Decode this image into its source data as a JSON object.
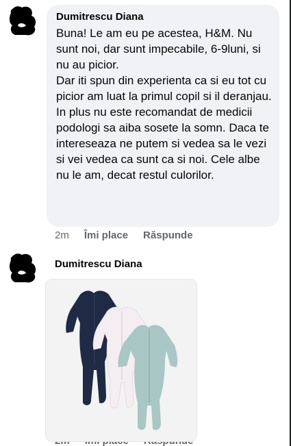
{
  "comment1": {
    "author": "Dumitrescu Diana",
    "text": "Buna! Le am eu pe acestea, H&M. Nu sunt noi, dar sunt impecabile, 6-9luni, si nu au picior.\nDar iti spun din experienta ca si eu tot cu picior am luat la primul copil si il deranjau. In plus nu este recomandat de medicii podologi sa aiba sosete la somn.  Daca te intereseaza ne putem si vedea sa le vezi si vei vedea ca sunt ca si noi. Cele albe nu le am, decat restul culorilor.",
    "time": "2m",
    "like_label": "Îmi place",
    "reply_label": "Răspunde"
  },
  "comment2": {
    "author": "Dumitrescu Diana",
    "photo": {
      "items": [
        {
          "name": "navy-sleepsuit",
          "color": "#1f2a44"
        },
        {
          "name": "white-sleepsuit",
          "color": "#f4eef3"
        },
        {
          "name": "mint-sleepsuit",
          "color": "#a9c7c4"
        }
      ]
    }
  },
  "icons": {
    "avatar": "user-silhouette-icon"
  }
}
